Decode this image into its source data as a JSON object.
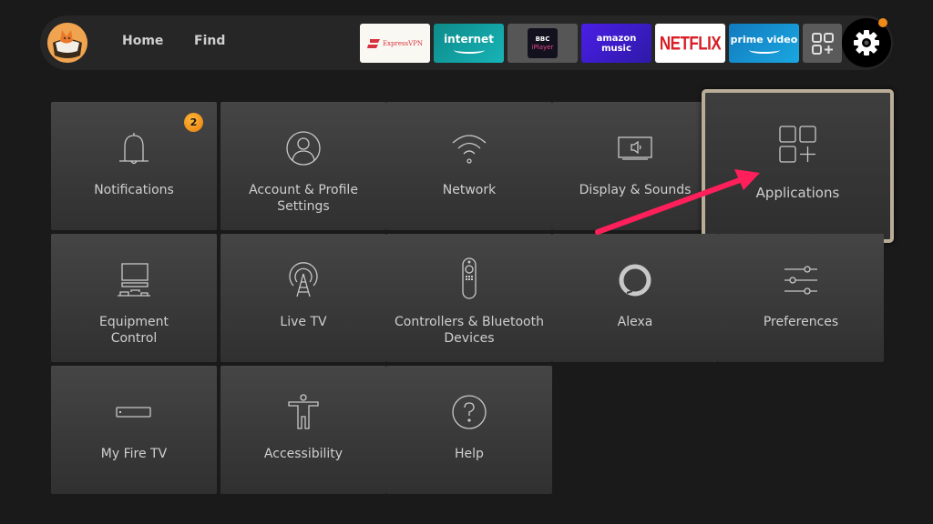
{
  "topbar": {
    "profile_icon": "fox-avatar-icon",
    "nav": [
      {
        "label": "Home"
      },
      {
        "label": "Find"
      }
    ],
    "apps": [
      {
        "name": "ExpressVPN",
        "label": "ExpressVPN",
        "bg": "#faf8f2"
      },
      {
        "name": "internet",
        "label": "internet",
        "bg": "#17b4b6"
      },
      {
        "name": "BBC iPlayer",
        "label_top": "BBC",
        "label_bottom": "iPlayer",
        "bg": "#14111e"
      },
      {
        "name": "amazon music",
        "label": "amazon music",
        "bg": "#4a1ee6"
      },
      {
        "name": "NETFLIX",
        "label": "NETFLIX",
        "bg": "#ffffff"
      },
      {
        "name": "prime video",
        "label": "prime video",
        "bg": "#1aa7e0"
      }
    ],
    "all_apps_icon": "apps-grid-plus-icon",
    "settings_icon": "gear-icon",
    "settings_dot_color": "#f08a1a"
  },
  "settings_tiles": [
    {
      "label": "Notifications",
      "icon": "bell-icon",
      "badge": "2"
    },
    {
      "label": "Account & Profile Settings",
      "icon": "user-circle-icon"
    },
    {
      "label": "Network",
      "icon": "wifi-icon"
    },
    {
      "label": "Display & Sounds",
      "icon": "tv-speaker-icon"
    },
    {
      "label": "Applications",
      "icon": "apps-grid-plus-icon",
      "focused": true
    },
    {
      "label": "Equipment Control",
      "icon": "equipment-icon"
    },
    {
      "label": "Live TV",
      "icon": "antenna-icon"
    },
    {
      "label": "Controllers & Bluetooth Devices",
      "icon": "remote-icon"
    },
    {
      "label": "Alexa",
      "icon": "alexa-ring-icon"
    },
    {
      "label": "Preferences",
      "icon": "sliders-icon"
    },
    {
      "label": "My Fire TV",
      "icon": "fire-tv-device-icon"
    },
    {
      "label": "Accessibility",
      "icon": "accessibility-icon"
    },
    {
      "label": "Help",
      "icon": "help-circle-icon"
    }
  ],
  "annotation": {
    "type": "arrow",
    "color": "#ff1f5a",
    "points_to": "Applications"
  }
}
